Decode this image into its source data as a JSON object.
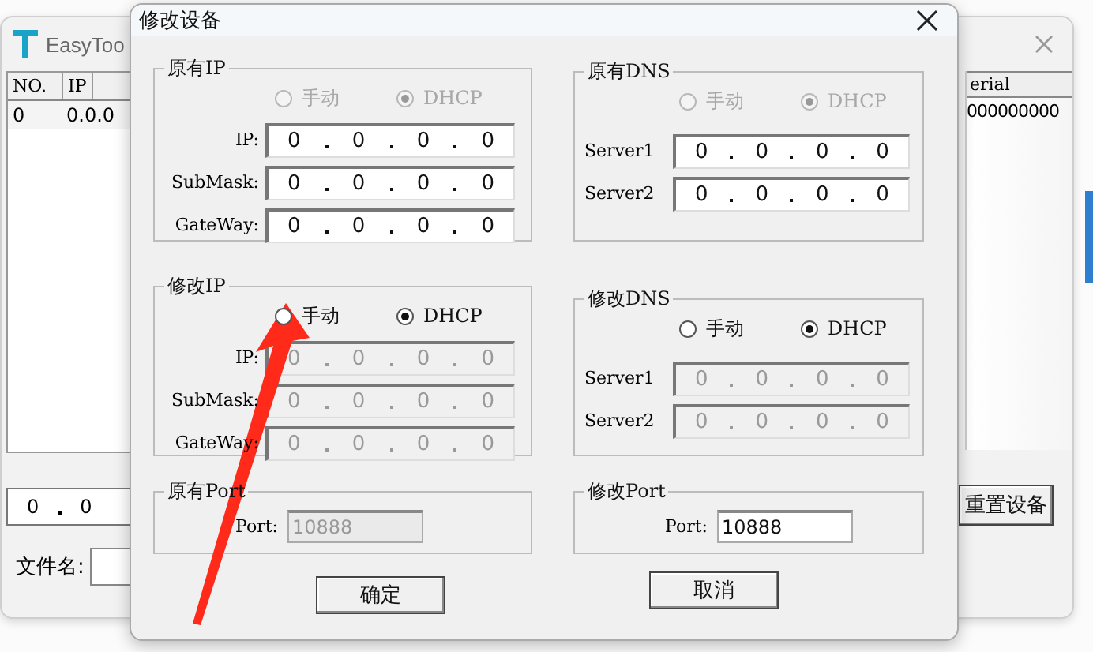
{
  "background_window": {
    "title": "EasyToo",
    "columns": [
      "NO.",
      "IP"
    ],
    "rows": [
      [
        "0",
        "0.0.0"
      ]
    ],
    "right_column": "erial",
    "right_cell": "000000000",
    "ip_field": [
      "0",
      "0"
    ],
    "file_label": "文件名:",
    "reset_button": "重置设备"
  },
  "dialog": {
    "title": "修改设备",
    "groups": [
      {
        "title": "原有IP",
        "radios": [
          {
            "label": "手动",
            "selected": false,
            "disabled": true
          },
          {
            "label": "DHCP",
            "selected": true,
            "disabled": true
          }
        ],
        "fields": [
          {
            "label": "IP:",
            "octets": [
              "0",
              "0",
              "0",
              "0"
            ],
            "disabled": false
          },
          {
            "label": "SubMask:",
            "octets": [
              "0",
              "0",
              "0",
              "0"
            ],
            "disabled": false
          },
          {
            "label": "GateWay:",
            "octets": [
              "0",
              "0",
              "0",
              "0"
            ],
            "disabled": false
          }
        ]
      },
      {
        "title": "原有DNS",
        "radios": [
          {
            "label": "手动",
            "selected": false,
            "disabled": true
          },
          {
            "label": "DHCP",
            "selected": true,
            "disabled": true
          }
        ],
        "fields": [
          {
            "label": "Server1",
            "octets": [
              "0",
              "0",
              "0",
              "0"
            ],
            "disabled": false
          },
          {
            "label": "Server2",
            "octets": [
              "0",
              "0",
              "0",
              "0"
            ],
            "disabled": false
          }
        ]
      },
      {
        "title": "修改IP",
        "radios": [
          {
            "label": "手动",
            "selected": false,
            "disabled": false
          },
          {
            "label": "DHCP",
            "selected": true,
            "disabled": false
          }
        ],
        "fields": [
          {
            "label": "IP:",
            "octets": [
              "0",
              "0",
              "0",
              "0"
            ],
            "disabled": true
          },
          {
            "label": "SubMask:",
            "octets": [
              "0",
              "0",
              "0",
              "0"
            ],
            "disabled": true
          },
          {
            "label": "GateWay:",
            "octets": [
              "0",
              "0",
              "0",
              "0"
            ],
            "disabled": true
          }
        ]
      },
      {
        "title": "修改DNS",
        "radios": [
          {
            "label": "手动",
            "selected": false,
            "disabled": false
          },
          {
            "label": "DHCP",
            "selected": true,
            "disabled": false
          }
        ],
        "fields": [
          {
            "label": "Server1",
            "octets": [
              "0",
              "0",
              "0",
              "0"
            ],
            "disabled": true
          },
          {
            "label": "Server2",
            "octets": [
              "0",
              "0",
              "0",
              "0"
            ],
            "disabled": true
          }
        ]
      }
    ],
    "ports": [
      {
        "title": "原有Port",
        "label": "Port:",
        "value": "10888",
        "disabled": true
      },
      {
        "title": "修改Port",
        "label": "Port:",
        "value": "10888",
        "disabled": false
      }
    ],
    "buttons": [
      "确定",
      "取消"
    ]
  }
}
